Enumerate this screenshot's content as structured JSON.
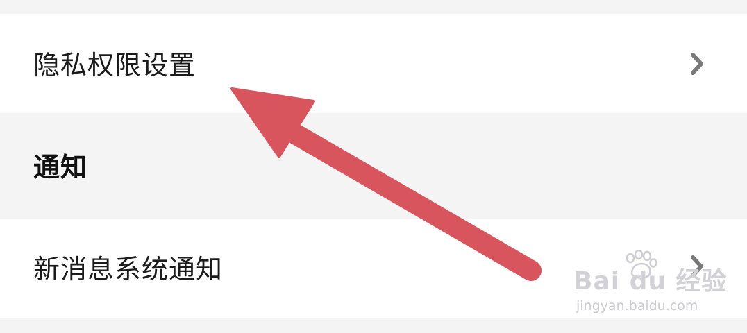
{
  "settings": {
    "privacy_label": "隐私权限设置",
    "notification_section_title": "通知",
    "new_message_label": "新消息系统通知"
  },
  "watermark": {
    "logo_text": "Bai du 经验",
    "url_text": "jingyan.baidu.com"
  },
  "icons": {
    "chevron": "chevron-right-icon",
    "annotation": "red-arrow-annotation",
    "watermark_paw": "baidu-paw-icon"
  },
  "colors": {
    "page_background": "#f4f4f5",
    "row_background": "#ffffff",
    "label_text": "#1b1b1b",
    "chevron": "#7a7a7a",
    "annotation_arrow": "#d9555e"
  }
}
